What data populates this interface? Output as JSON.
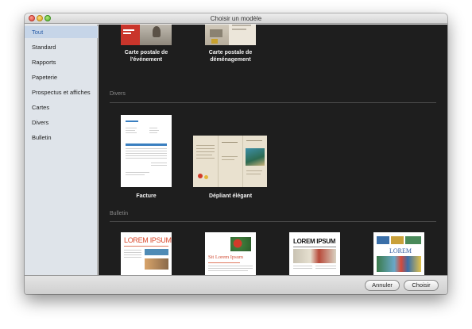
{
  "window": {
    "title": "Choisir un modèle"
  },
  "sidebar": {
    "items": [
      {
        "label": "Tout",
        "active": true
      },
      {
        "label": "Standard"
      },
      {
        "label": "Rapports"
      },
      {
        "label": "Papeterie"
      },
      {
        "label": "Prospectus et affiches"
      },
      {
        "label": "Cartes"
      },
      {
        "label": "Divers"
      },
      {
        "label": "Bulletin"
      }
    ]
  },
  "content": {
    "top_templates": [
      {
        "line1": "Carte postale de",
        "line2": "l'événement"
      },
      {
        "line1": "Carte postale de",
        "line2": "déménagement"
      }
    ],
    "sections": [
      {
        "label": "Divers",
        "templates": [
          {
            "name": "Facture"
          },
          {
            "name": "Dépliant élégant"
          }
        ]
      },
      {
        "label": "Bulletin",
        "templates": [
          {
            "thumb_title": "LOREM IPSUM"
          },
          {
            "thumb_title": "Sit Lorem Ipsum"
          },
          {
            "thumb_title": "LOREM IPSUM"
          },
          {
            "thumb_title": "LOREM"
          }
        ]
      }
    ]
  },
  "buttons": {
    "cancel": "Annuler",
    "choose": "Choisir"
  }
}
